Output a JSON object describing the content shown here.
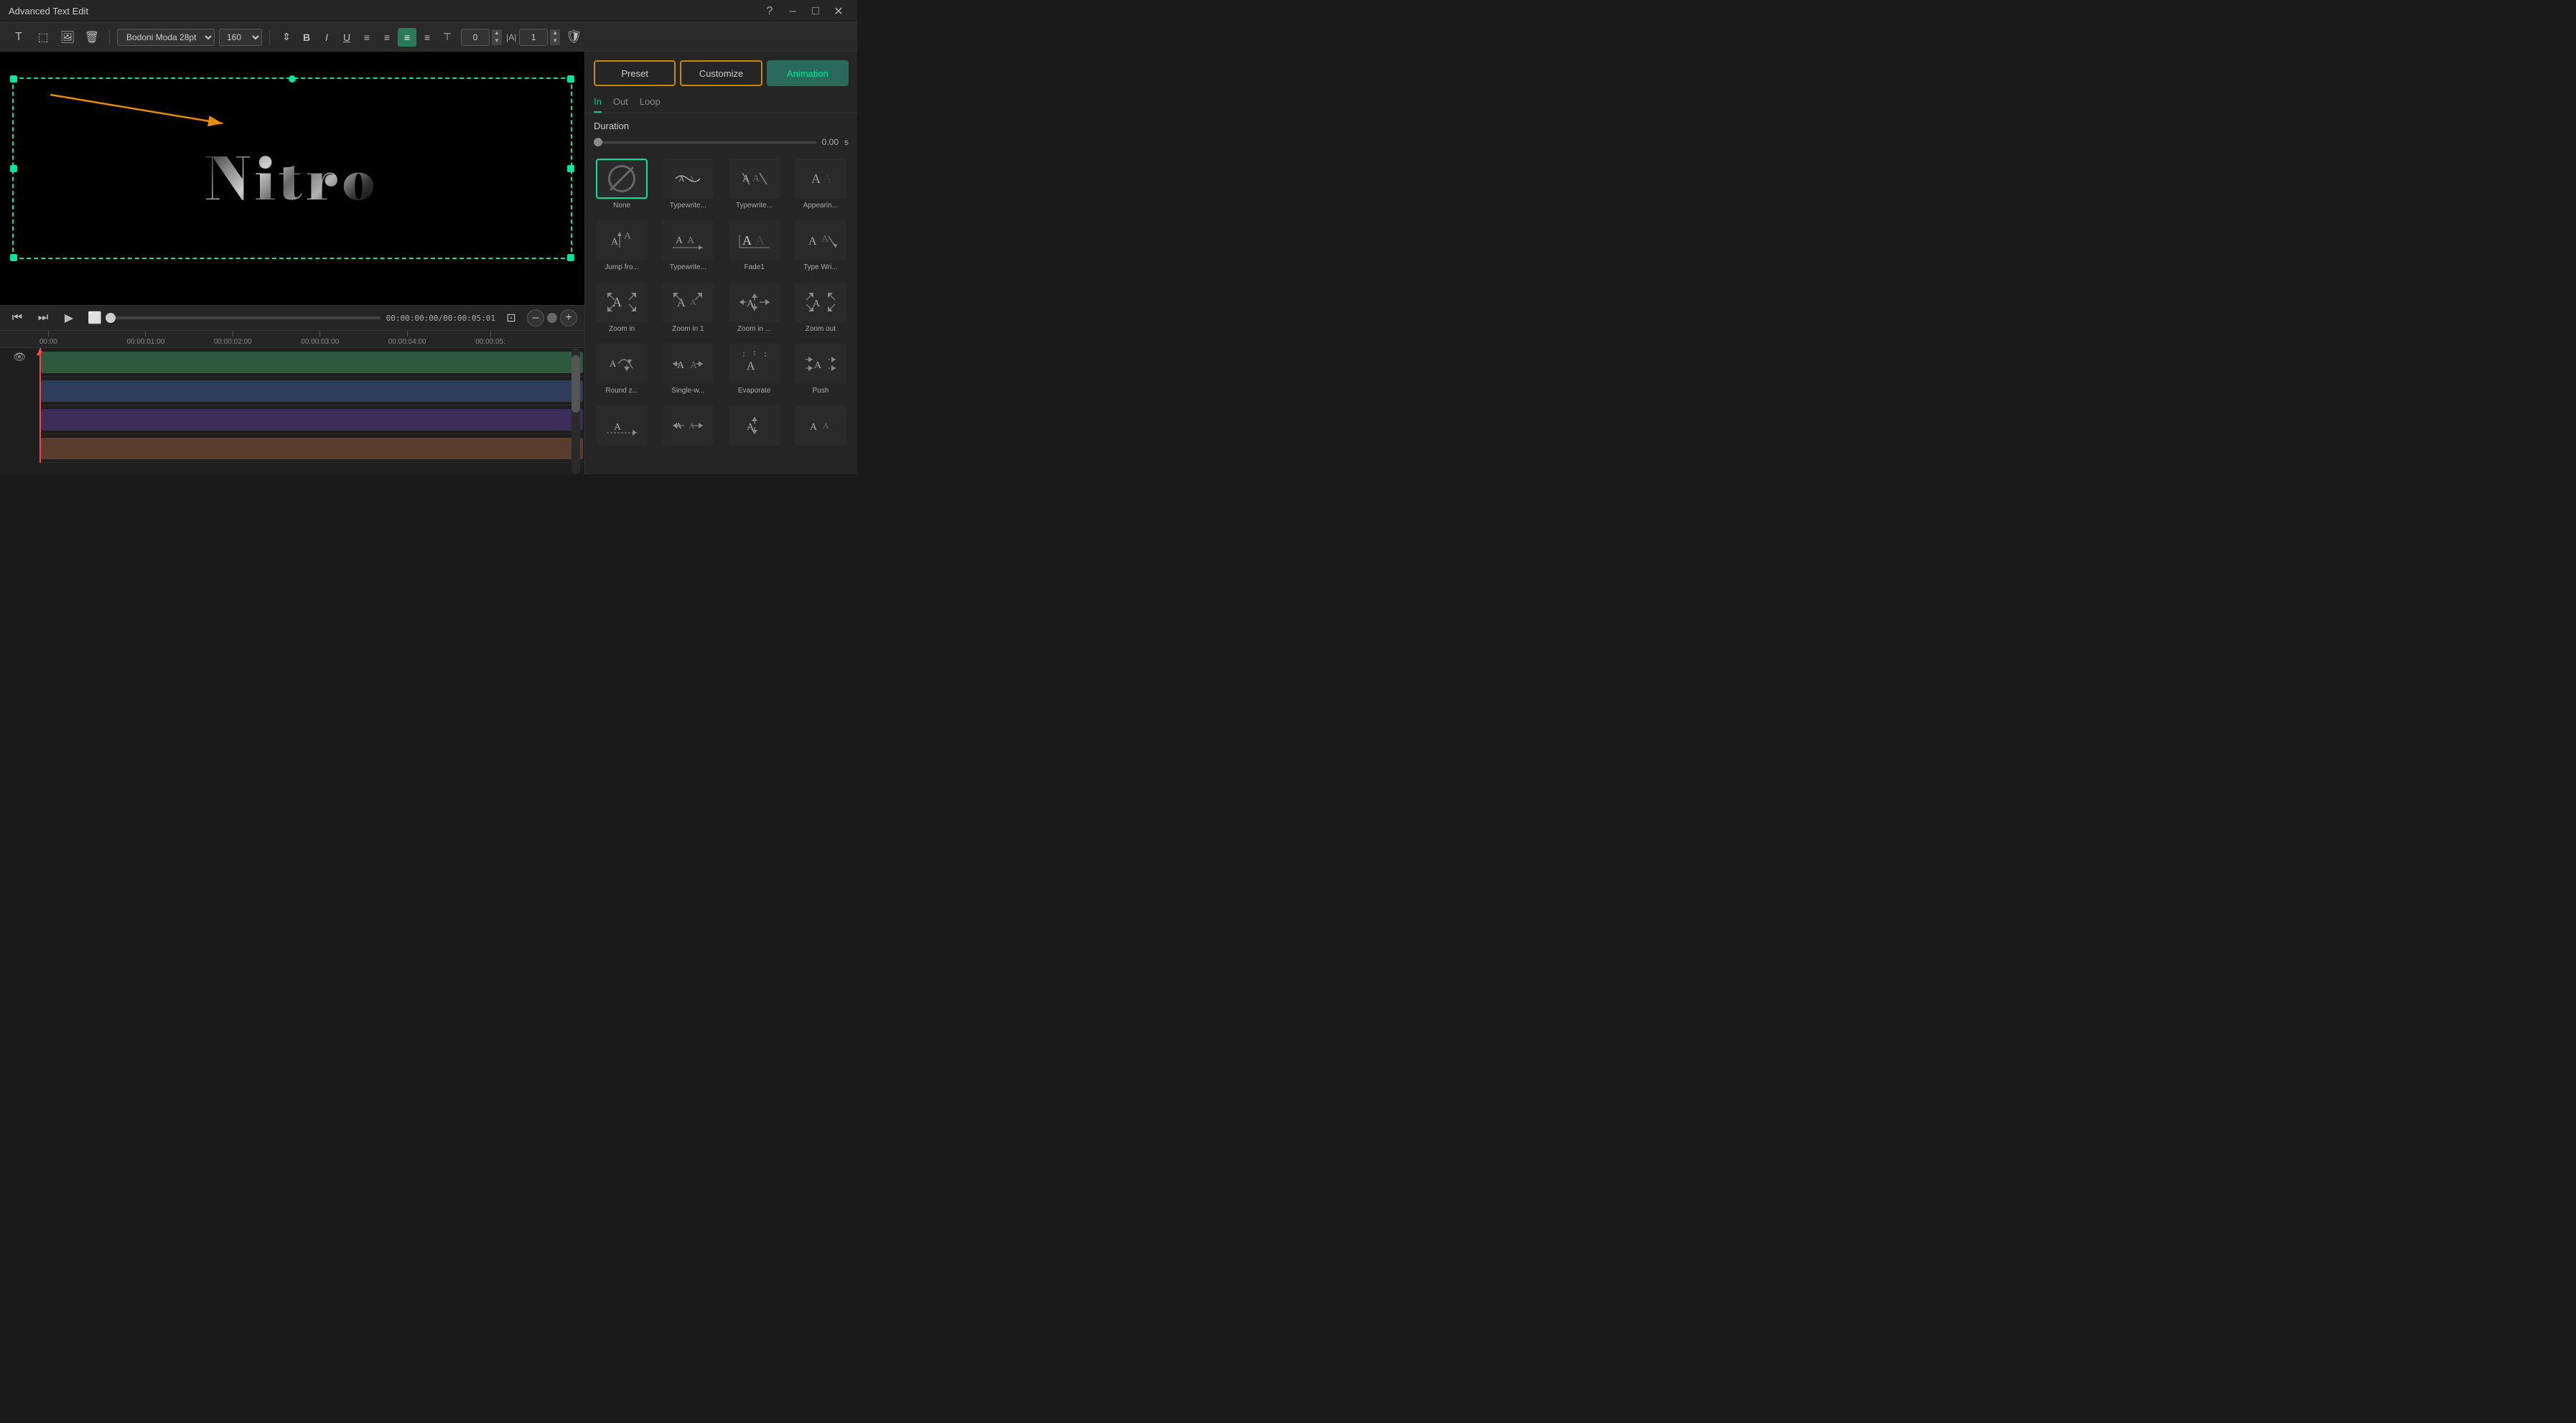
{
  "titleBar": {
    "title": "Advanced Text Edit",
    "help": "?",
    "minimize": "–",
    "maximize": "□",
    "close": "✕"
  },
  "toolbar": {
    "font": "Bodoni Moda 28pt",
    "fontSize": "160",
    "boldLabel": "B",
    "italicLabel": "I",
    "underlineLabel": "U",
    "kerningValue": "0",
    "leadingValue": "1"
  },
  "canvas": {
    "text": "Nitro",
    "timeCode": "00:00:00:00/00:00:05:01"
  },
  "timeline": {
    "marks": [
      "00:00",
      "00:00:01:00",
      "00:00:02:00",
      "00:00:03:00",
      "00:00:04:00",
      "00:00:05:"
    ]
  },
  "rightPanel": {
    "tabs": {
      "preset": "Preset",
      "customize": "Customize",
      "animation": "Animation"
    },
    "subTabs": {
      "in": "In",
      "out": "Out",
      "loop": "Loop"
    },
    "duration": {
      "label": "Duration",
      "value": "0.00",
      "unit": "s"
    },
    "animations": [
      {
        "id": "none",
        "label": "None",
        "selected": true
      },
      {
        "id": "typewrite1",
        "label": "Typewrite..."
      },
      {
        "id": "typewrite2",
        "label": "Typewrite..."
      },
      {
        "id": "appearing",
        "label": "Appearin..."
      },
      {
        "id": "jumpfrom",
        "label": "Jump fro..."
      },
      {
        "id": "typewrite3",
        "label": "Typewrite..."
      },
      {
        "id": "fade1",
        "label": "Fade1"
      },
      {
        "id": "typewrite4",
        "label": "Type Wri..."
      },
      {
        "id": "zoomin",
        "label": "Zoom in"
      },
      {
        "id": "zoomin1",
        "label": "Zoom in 1"
      },
      {
        "id": "zoomin2",
        "label": "Zoom in ..."
      },
      {
        "id": "zoomout",
        "label": "Zoom out"
      },
      {
        "id": "roundz",
        "label": "Round z..."
      },
      {
        "id": "singlew",
        "label": "Single-w..."
      },
      {
        "id": "evaporate",
        "label": "Evaporate"
      },
      {
        "id": "push",
        "label": "Push"
      },
      {
        "id": "anim17",
        "label": ""
      },
      {
        "id": "anim18",
        "label": ""
      },
      {
        "id": "anim19",
        "label": ""
      },
      {
        "id": "anim20",
        "label": ""
      }
    ]
  }
}
